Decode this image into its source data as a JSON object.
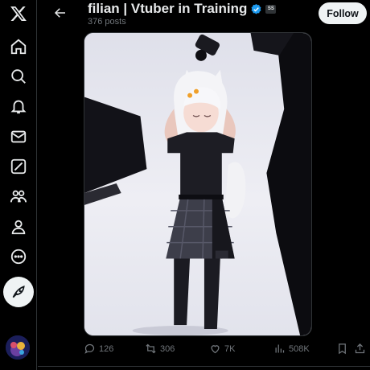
{
  "nav": {
    "items": [
      {
        "icon": "x-logo-icon"
      },
      {
        "icon": "home-icon"
      },
      {
        "icon": "search-icon"
      },
      {
        "icon": "bell-icon"
      },
      {
        "icon": "mail-icon"
      },
      {
        "icon": "grok-icon"
      },
      {
        "icon": "communities-icon"
      },
      {
        "icon": "profile-icon"
      },
      {
        "icon": "more-icon"
      }
    ],
    "post_icon": "quill-icon"
  },
  "header": {
    "name": "filian | Vtuber in Training",
    "posts": "376 posts",
    "follow_label": "Follow",
    "affiliate_badge": "SS"
  },
  "tweet": {
    "replies": "126",
    "reposts": "306",
    "likes": "7K",
    "views": "508K"
  },
  "colors": {
    "background": "#000000",
    "verified": "#1d9bf0",
    "muted": "#71767b",
    "text": "#e7e9ea"
  }
}
